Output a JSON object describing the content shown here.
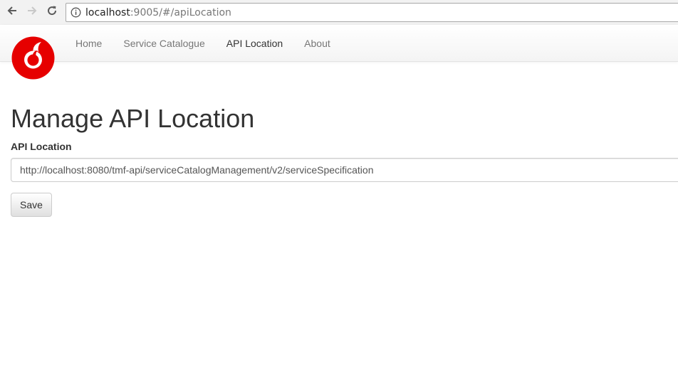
{
  "browser": {
    "url_host": "localhost",
    "url_rest": ":9005/#/apiLocation",
    "icons": {
      "back": "arrow-left-icon",
      "forward": "arrow-right-icon",
      "reload": "reload-icon",
      "info": "info-icon"
    }
  },
  "navbar": {
    "logo": "vodafone-logo",
    "brand_color": "#e60000",
    "items": [
      {
        "label": "Home"
      },
      {
        "label": "Service Catalogue"
      },
      {
        "label": "API Location"
      },
      {
        "label": "About"
      }
    ],
    "active_item": "API Location"
  },
  "main": {
    "title": "Manage API Location",
    "field_label": "API Location",
    "field_value": "http://localhost:8080/tmf-api/serviceCatalogManagement/v2/serviceSpecification",
    "save_label": "Save"
  }
}
